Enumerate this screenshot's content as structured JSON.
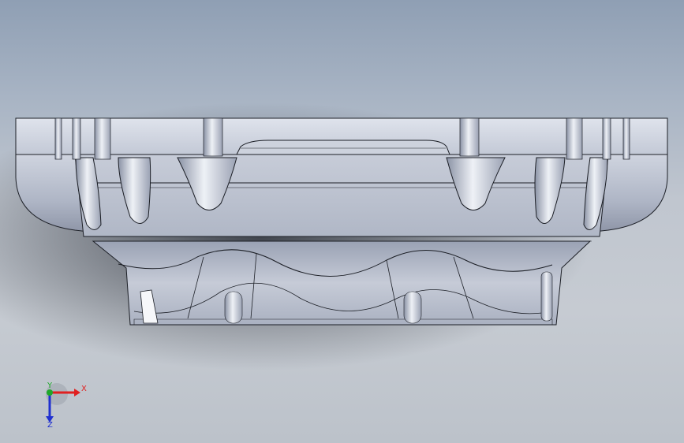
{
  "viewport": {
    "view_style": "shaded-with-edges",
    "colors": {
      "background_top": "#8f9fb4",
      "background_bottom": "#c6cbd2",
      "part_light": "#d5dae5",
      "part_mid": "#b4bccc",
      "part_dark": "#8e96a8",
      "edge": "#1c1f26"
    }
  },
  "triad": {
    "x_label": "X",
    "y_label": "Y",
    "z_label": "Z",
    "x_color": "#e02020",
    "y_color": "#1fa82a",
    "z_color": "#2030d0"
  }
}
